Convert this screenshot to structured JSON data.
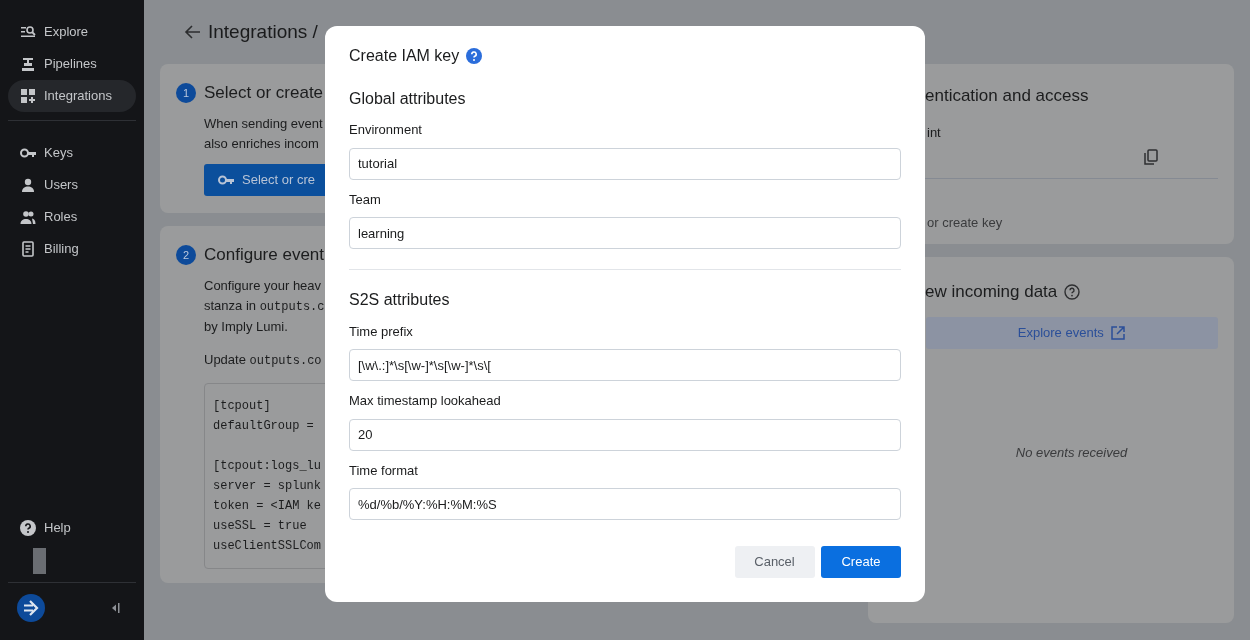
{
  "sidebar": {
    "sections": [
      [
        {
          "label": "Explore",
          "selected": false
        },
        {
          "label": "Pipelines",
          "selected": false
        },
        {
          "label": "Integrations",
          "selected": true
        }
      ],
      [
        {
          "label": "Keys",
          "selected": false
        },
        {
          "label": "Users",
          "selected": false
        },
        {
          "label": "Roles",
          "selected": false
        },
        {
          "label": "Billing",
          "selected": false
        }
      ]
    ],
    "help": "Help"
  },
  "page": {
    "title": "Integrations /"
  },
  "steps": [
    {
      "number": "1",
      "title": "Select or create",
      "paragraphs": [
        {
          "text": "When sending event"
        },
        {
          "text": "also enriches incom"
        }
      ],
      "button": "Select or cre"
    },
    {
      "number": "2",
      "title": "Configure event",
      "paragraphs": [
        {
          "text": "Configure your heav"
        },
        {
          "text": "stanza in",
          "code": "outputs.c"
        },
        {
          "text": "by Imply Lumi."
        }
      ],
      "note": {
        "text": "Update",
        "code": "outputs.co"
      },
      "code": [
        [
          "[tcpout]",
          "defaultGroup ="
        ],
        [
          "[tcpout:logs_lu",
          "server = splunk",
          "token = <IAM ke",
          "useSSL = true",
          "useClientSSLCom"
        ]
      ]
    }
  ],
  "auth": {
    "title": "entication and access",
    "field_label": "int",
    "link": "or create key"
  },
  "incoming": {
    "title": "ew incoming data",
    "button": "Explore events",
    "empty": "No events received"
  },
  "modal": {
    "title": "Create IAM key",
    "sections": [
      {
        "heading": "Global attributes",
        "fields": [
          {
            "label": "Environment",
            "value": "tutorial"
          },
          {
            "label": "Team",
            "value": "learning"
          }
        ]
      },
      {
        "heading": "S2S attributes",
        "fields": [
          {
            "label": "Time prefix",
            "value": "[\\w\\.:]*\\s[\\w-]*\\s[\\w-]*\\s\\["
          },
          {
            "label": "Max timestamp lookahead",
            "value": "20"
          },
          {
            "label": "Time format",
            "value": "%d/%b/%Y:%H:%M:%S"
          }
        ]
      }
    ],
    "buttons": [
      {
        "label": "Cancel",
        "kind": "secondary"
      },
      {
        "label": "Create",
        "kind": "primary"
      }
    ]
  }
}
